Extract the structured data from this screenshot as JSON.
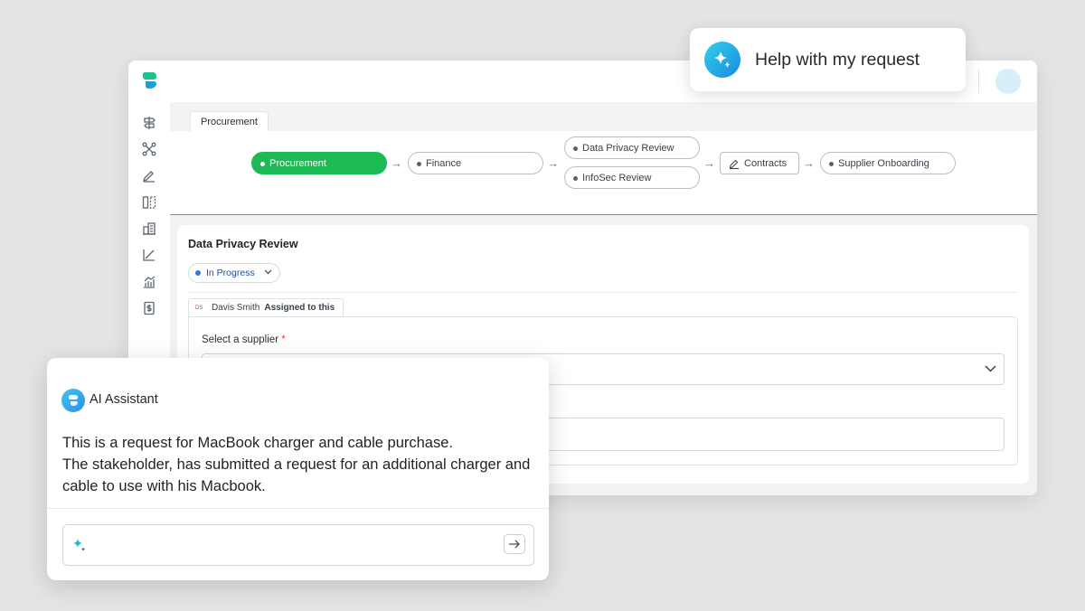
{
  "help_bubble": {
    "label": "Help with my request",
    "icon": "sparkle-icon"
  },
  "sidebar": {
    "logo": "brand-logo",
    "icons": [
      "signpost-icon",
      "workflow-icon",
      "pen-sign-icon",
      "columns-icon",
      "buildings-icon",
      "line-chart-icon",
      "analytics-icon",
      "dollar-doc-icon"
    ]
  },
  "tabs": [
    {
      "label": "Procurement",
      "selected": true
    }
  ],
  "workflow": {
    "steps": [
      {
        "label": "Procurement",
        "status": "active"
      },
      {
        "label": "Finance"
      },
      {
        "label": "Data Privacy Review"
      },
      {
        "label": "InfoSec Review"
      },
      {
        "label": "Contracts",
        "icon": "pen-sign-icon"
      },
      {
        "label": "Supplier Onboarding"
      }
    ]
  },
  "review": {
    "title": "Data Privacy Review",
    "status": "In Progress",
    "assignee": {
      "initials": "DS",
      "name": "Davis Smith",
      "note": "Assigned to this"
    },
    "supplier_label": "Select a supplier",
    "required_mark": "*"
  },
  "assistant": {
    "title": "AI Assistant",
    "message_lines": [
      "This is a request for MacBook charger and cable purchase.",
      "The stakeholder, has submitted a request for an additional charger and cable to use with his Macbook."
    ],
    "input_placeholder": ""
  },
  "colors": {
    "accent_green": "#1db954",
    "status_blue": "#2b7bd9",
    "assistant_gradient": [
      "#41c6f0",
      "#2c8ee8"
    ]
  }
}
